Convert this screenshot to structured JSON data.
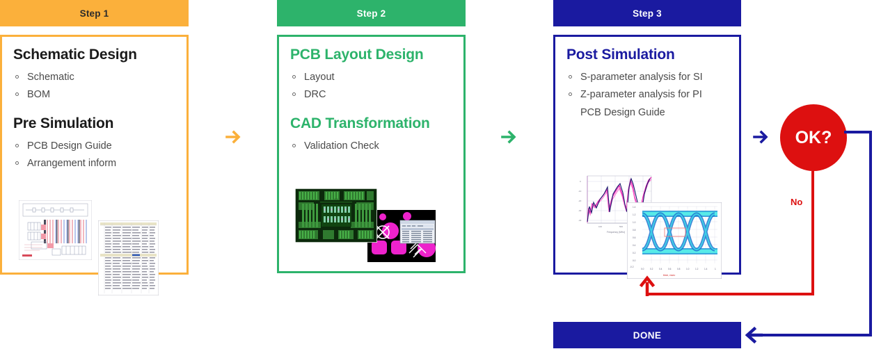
{
  "steps": [
    {
      "header": "Step 1",
      "accent": "#FBB03B",
      "sections": [
        {
          "title": "Schematic Design",
          "items": [
            "Schematic",
            "BOM"
          ]
        },
        {
          "title": "Pre Simulation",
          "items": [
            "PCB Design Guide",
            "Arrangement inform"
          ]
        }
      ],
      "figures": [
        "schematic-diagram-thumbnail",
        "bom-table-thumbnail"
      ]
    },
    {
      "header": "Step 2",
      "accent": "#2DB36B",
      "sections": [
        {
          "title": "PCB Layout Design",
          "items": [
            "Layout",
            "DRC"
          ]
        },
        {
          "title": "CAD Transformation",
          "items": [
            "Validation Check"
          ]
        }
      ],
      "figures": [
        "pcb-layout-thumbnail",
        "cad-transformation-thumbnail"
      ]
    },
    {
      "header": "Step 3",
      "accent": "#1A1AA0",
      "sections": [
        {
          "title": "Post Simulation",
          "items": [
            "S-parameter analysis for SI",
            "Z-parameter analysis for PI"
          ],
          "continuation": "PCB Design Guide"
        }
      ],
      "figures": [
        "s-parameter-plot-thumbnail",
        "eye-diagram-thumbnail"
      ]
    }
  ],
  "arrows": [
    {
      "name": "arrow-step1-to-step2",
      "color": "#FBB03B"
    },
    {
      "name": "arrow-step2-to-step3",
      "color": "#2DB36B"
    },
    {
      "name": "arrow-step3-to-decision",
      "color": "#1A1AA0"
    }
  ],
  "decision": {
    "label": "OK?",
    "color": "#DD1010",
    "no_label": "No"
  },
  "done": {
    "label": "DONE",
    "color": "#1A1AA0"
  },
  "figure_labels": {
    "sparam_xaxis": "Frequency (MHz)",
    "eye_xaxis": "time, nsec"
  }
}
